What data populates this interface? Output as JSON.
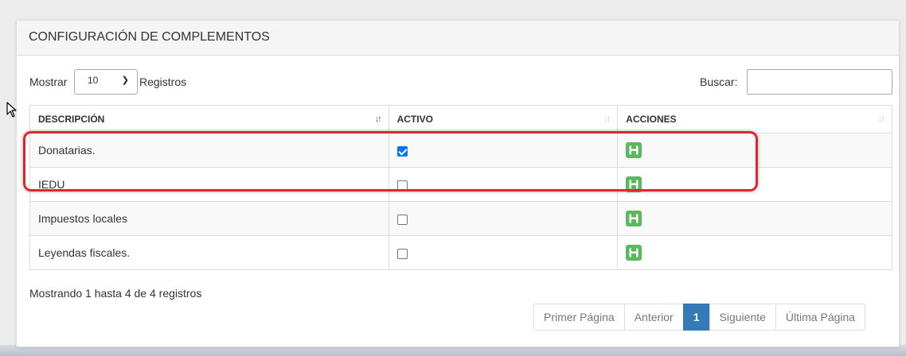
{
  "panel": {
    "title": "CONFIGURACIÓN DE COMPLEMENTOS"
  },
  "length": {
    "label": "Mostrar",
    "selected": "10",
    "suffix": "Registros"
  },
  "search": {
    "label": "Buscar:",
    "value": ""
  },
  "table": {
    "headers": [
      "DESCRIPCIÓN",
      "ACTIVO",
      "ACCIONES"
    ],
    "rows": [
      {
        "descripcion": "Donatarias.",
        "activo": true,
        "action_icon": "save-icon"
      },
      {
        "descripcion": "IEDU",
        "activo": false,
        "action_icon": "save-icon"
      },
      {
        "descripcion": "Impuestos locales",
        "activo": false,
        "action_icon": "save-icon"
      },
      {
        "descripcion": "Leyendas fiscales.",
        "activo": false,
        "action_icon": "save-icon"
      }
    ]
  },
  "info": "Mostrando 1 hasta 4 de 4 registros",
  "pagination": {
    "first": "Primer Página",
    "prev": "Anterior",
    "current": "1",
    "next": "Siguiente",
    "last": "Última Página"
  },
  "colors": {
    "save_button": "#5cb85c",
    "active_page": "#337ab7",
    "highlight": "#e0262e",
    "checkbox": "#0075ff"
  },
  "icons": {
    "sort": "sort-arrows-icon",
    "save": "floppy-disk-icon",
    "cursor": "mouse-pointer-icon"
  }
}
